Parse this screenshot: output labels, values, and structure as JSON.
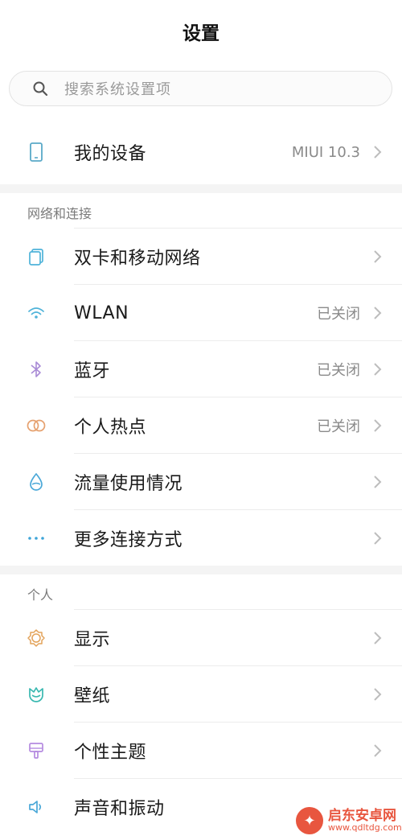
{
  "header": {
    "title": "设置"
  },
  "search": {
    "placeholder": "搜索系统设置项"
  },
  "device": {
    "label": "我的设备",
    "value": "MIUI 10.3"
  },
  "sections": [
    {
      "header": "网络和连接",
      "items": [
        {
          "label": "双卡和移动网络",
          "value": ""
        },
        {
          "label": "WLAN",
          "value": "已关闭"
        },
        {
          "label": "蓝牙",
          "value": "已关闭"
        },
        {
          "label": "个人热点",
          "value": "已关闭"
        },
        {
          "label": "流量使用情况",
          "value": ""
        },
        {
          "label": "更多连接方式",
          "value": ""
        }
      ]
    },
    {
      "header": "个人",
      "items": [
        {
          "label": "显示",
          "value": ""
        },
        {
          "label": "壁纸",
          "value": ""
        },
        {
          "label": "个性主题",
          "value": ""
        },
        {
          "label": "声音和振动",
          "value": ""
        }
      ]
    }
  ],
  "watermark": {
    "name": "启东安卓网",
    "url": "www.qdltdg.com"
  },
  "colors": {
    "device": "#5aa9c8",
    "sim": "#4fb3d9",
    "wlan": "#4fb3d9",
    "bluetooth": "#a98bd6",
    "hotspot": "#e6a16f",
    "data": "#4aa8d8",
    "more": "#3fa5d8",
    "display": "#e3a35a",
    "wallpaper": "#39b8b0",
    "theme": "#b58be0",
    "sound": "#4aa8d8",
    "chevron": "#bdbdbd"
  }
}
